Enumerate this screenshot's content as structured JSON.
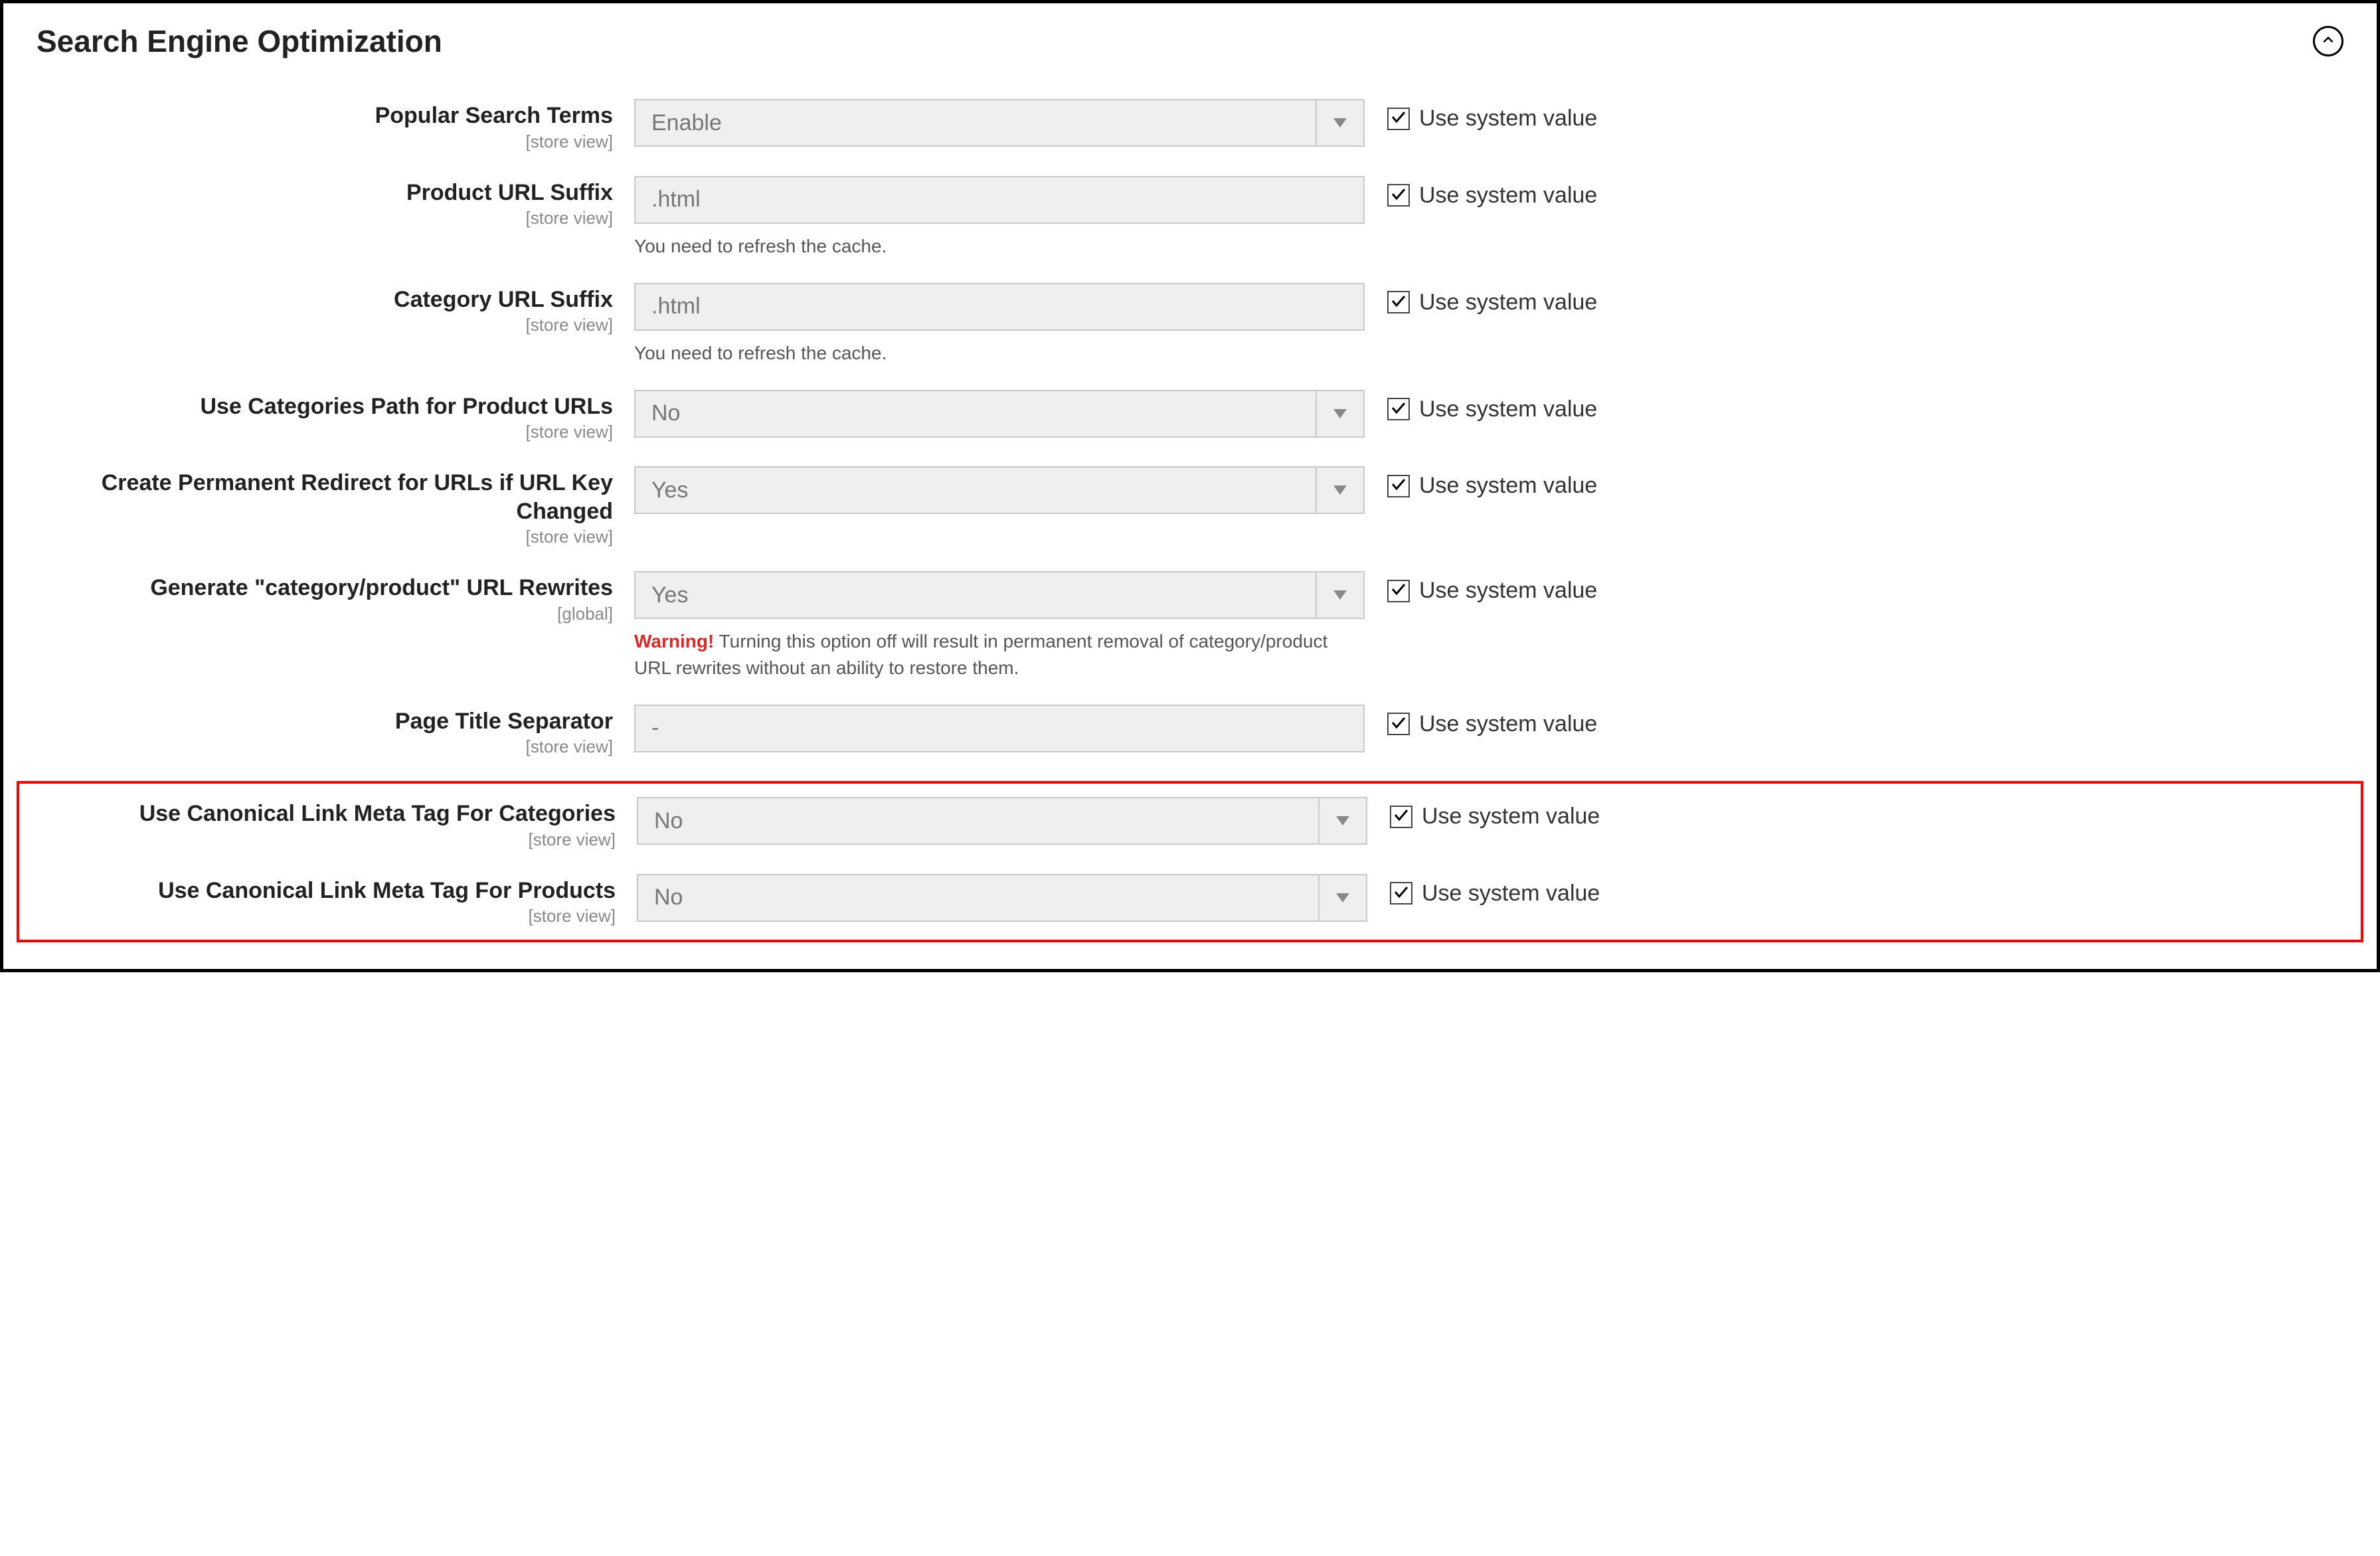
{
  "section": {
    "title": "Search Engine Optimization"
  },
  "common": {
    "scope_store_view": "[store view]",
    "scope_global": "[global]",
    "use_system_value": "Use system value",
    "refresh_cache_note": "You need to refresh the cache."
  },
  "fields": {
    "popular_search_terms": {
      "label": "Popular Search Terms",
      "value": "Enable"
    },
    "product_url_suffix": {
      "label": "Product URL Suffix",
      "value": ".html"
    },
    "category_url_suffix": {
      "label": "Category URL Suffix",
      "value": ".html"
    },
    "categories_path": {
      "label": "Use Categories Path for Product URLs",
      "value": "No"
    },
    "permanent_redirect": {
      "label": "Create Permanent Redirect for URLs if URL Key Changed",
      "value": "Yes"
    },
    "generate_rewrites": {
      "label": "Generate \"category/product\" URL Rewrites",
      "value": "Yes",
      "warning_label": "Warning!",
      "warning_text": " Turning this option off will result in permanent removal of category/product URL rewrites without an ability to restore them."
    },
    "page_title_separator": {
      "label": "Page Title Separator",
      "value": "-"
    },
    "canonical_categories": {
      "label": "Use Canonical Link Meta Tag For Categories",
      "value": "No"
    },
    "canonical_products": {
      "label": "Use Canonical Link Meta Tag For Products",
      "value": "No"
    }
  }
}
